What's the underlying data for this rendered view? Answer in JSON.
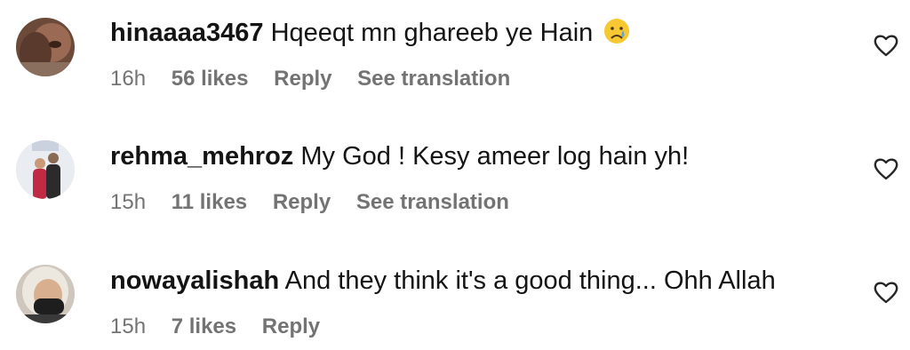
{
  "comments": [
    {
      "username": "hinaaaa3467",
      "text": "Hqeeqt mn ghareeb ye Hain",
      "emoji": "crying-face",
      "time": "16h",
      "likes": "56 likes",
      "reply": "Reply",
      "translation": "See translation"
    },
    {
      "username": "rehma_mehroz",
      "text": "My God ! Kesy ameer log hain yh!",
      "time": "15h",
      "likes": "11 likes",
      "reply": "Reply",
      "translation": "See translation"
    },
    {
      "username": "nowayalishah",
      "text": "And they think it's a good thing... Ohh Allah",
      "time": "15h",
      "likes": "7 likes",
      "reply": "Reply"
    }
  ]
}
